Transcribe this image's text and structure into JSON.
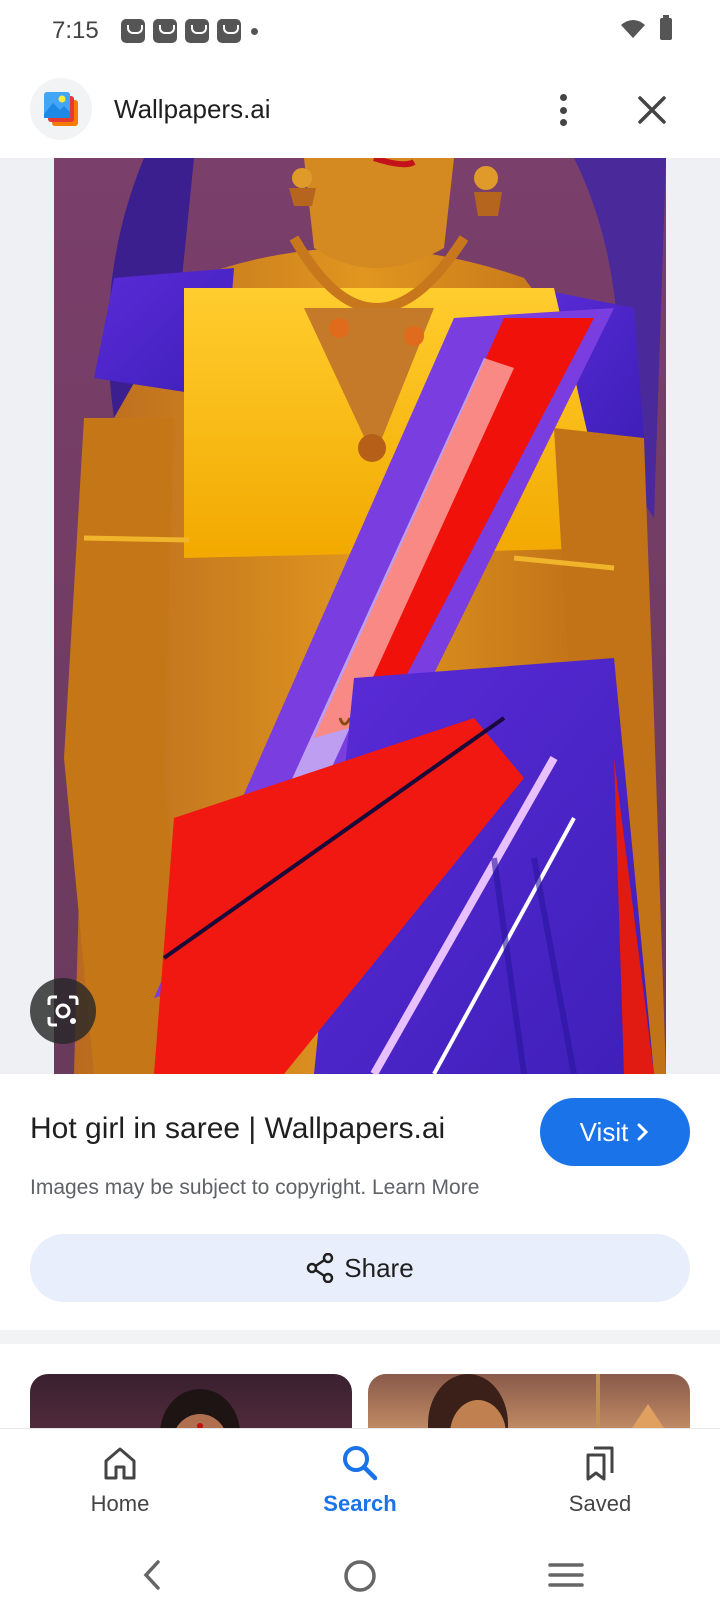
{
  "status_bar": {
    "time": "7:15",
    "notification_icons": [
      "bag-icon",
      "bag-icon",
      "bag-icon",
      "bag-icon"
    ]
  },
  "header": {
    "site_name": "Wallpapers.ai",
    "logo_icon": "wallpapers-logo-icon",
    "more_icon": "more-vert-icon",
    "close_icon": "close-icon"
  },
  "result": {
    "title": "Hot girl in saree | Wallpapers.ai",
    "visit_label": "Visit",
    "copyright_notice": "Images may be subject to copyright. Learn More",
    "share_label": "Share"
  },
  "bottom_nav": {
    "items": [
      {
        "label": "Home",
        "icon": "home-icon"
      },
      {
        "label": "Search",
        "icon": "search-icon",
        "active": true
      },
      {
        "label": "Saved",
        "icon": "bookmarks-icon"
      }
    ]
  },
  "colors": {
    "accent": "#1a73e8",
    "share_bg": "#e8eefc",
    "image_bg": "#eef0f3"
  }
}
